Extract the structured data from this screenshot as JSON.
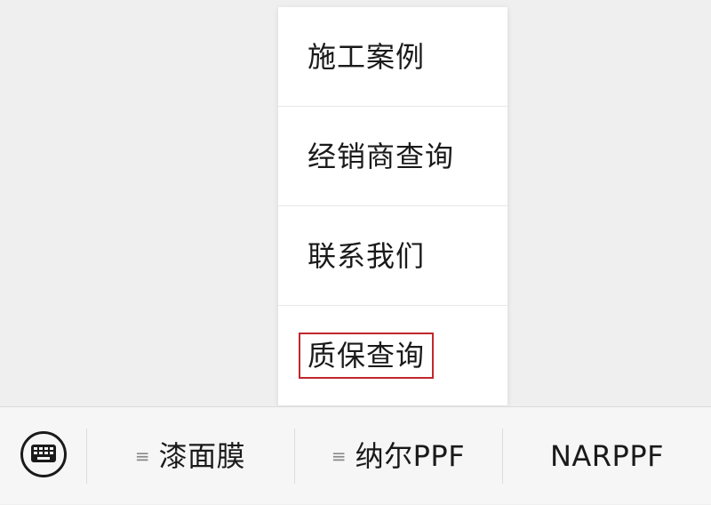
{
  "popup_menu": {
    "items": [
      {
        "label": "施工案例"
      },
      {
        "label": "经销商查询"
      },
      {
        "label": "联系我们"
      },
      {
        "label": "质保查询",
        "highlighted": true
      }
    ]
  },
  "bottom_bar": {
    "keyboard_icon": "keyboard-icon",
    "tabs": [
      {
        "label": "漆面膜",
        "icon": "menu-lines-icon",
        "icon_glyph": "≡"
      },
      {
        "label": "纳尔PPF",
        "icon": "menu-lines-icon",
        "icon_glyph": "≡"
      },
      {
        "label": "NARPPF"
      }
    ]
  },
  "colors": {
    "highlight_border": "#c1272d",
    "background": "#efefef",
    "menu_background": "#ffffff"
  }
}
